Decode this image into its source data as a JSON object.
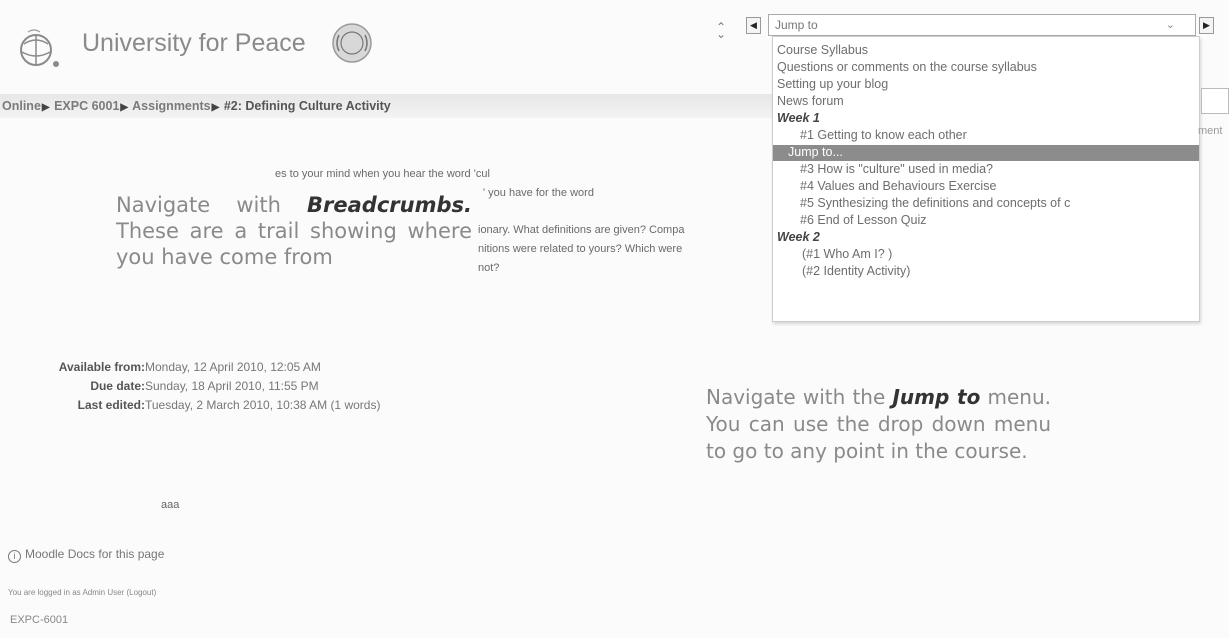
{
  "header": {
    "site_title": "University for Peace"
  },
  "breadcrumb": {
    "items": [
      "Online",
      "EXPC 6001",
      "Assignments"
    ],
    "current": "#2: Defining Culture Activity"
  },
  "jump_menu": {
    "selected_label": "Jump to",
    "options": [
      {
        "label": "Course Syllabus",
        "kind": "item"
      },
      {
        "label": "Questions or comments on the course syllabus",
        "kind": "item"
      },
      {
        "label": "Setting up your blog",
        "kind": "item"
      },
      {
        "label": "News forum",
        "kind": "item"
      },
      {
        "label": "Week 1",
        "kind": "group"
      },
      {
        "label": "#1  Getting to know each other",
        "kind": "item"
      },
      {
        "label": "Jump to...",
        "kind": "selected"
      },
      {
        "label": "#3  How is \"culture\" used in media?",
        "kind": "item"
      },
      {
        "label": "#4  Values and Behaviours Exercise",
        "kind": "item"
      },
      {
        "label": "#5  Synthesizing the definitions and concepts of c",
        "kind": "item"
      },
      {
        "label": "#6  End of Lesson Quiz",
        "kind": "item"
      },
      {
        "label": "Week 2",
        "kind": "group"
      },
      {
        "label": "(#1  Who Am I? )",
        "kind": "item"
      },
      {
        "label": "(#2  Identity Activity)",
        "kind": "item"
      }
    ],
    "side_text": "ment"
  },
  "intro": {
    "line1": "es to your mind when you hear the word 'cul",
    "line2": "' you have for the word",
    "line3": "ionary. What definitions are given? Compa",
    "line4": "nitions were related to yours? Which were",
    "line5": "not?"
  },
  "callouts": {
    "breadcrumbs": {
      "prefix": "Navigate with ",
      "emphasis": "Breadcrumbs.",
      "body": "These are a trail showing where you have come from"
    },
    "jump_to": {
      "prefix": "Navigate with the  ",
      "emphasis": "Jump to",
      "body": "menu. You can use the drop down menu to go to any point in the course."
    }
  },
  "assignment": {
    "available_label": "Available from:",
    "available_value": "Monday, 12 April 2010, 12:05 AM",
    "due_label": "Due date:",
    "due_value": "Sunday, 18 April 2010, 11:55 PM",
    "edited_label": "Last edited:",
    "edited_value": "Tuesday, 2 March 2010, 10:38 AM (1 words)",
    "submission_text": "aaa"
  },
  "footer": {
    "docs_link": "Moodle Docs for this page",
    "logged_in_prefix": "You are logged in as ",
    "user_name": "Admin User",
    "logout": "(Logout)",
    "course_short": "EXPC-6001"
  }
}
